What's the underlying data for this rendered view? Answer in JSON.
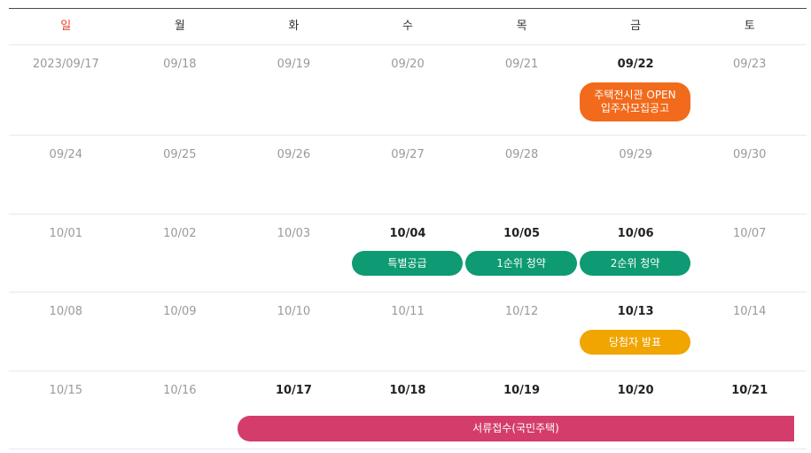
{
  "weekdays": [
    "일",
    "월",
    "화",
    "수",
    "목",
    "금",
    "토"
  ],
  "colors": {
    "sunday": "#e8462a",
    "green": "#0e9a72",
    "orange": "#f26a1b",
    "yellow": "#f0a500",
    "pink": "#d43d6b"
  },
  "weeks": [
    {
      "days": [
        "2023/09/17",
        "09/18",
        "09/19",
        "09/20",
        "09/21",
        "09/22",
        "09/23"
      ]
    },
    {
      "days": [
        "09/24",
        "09/25",
        "09/26",
        "09/27",
        "09/28",
        "09/29",
        "09/30"
      ]
    },
    {
      "days": [
        "10/01",
        "10/02",
        "10/03",
        "10/04",
        "10/05",
        "10/06",
        "10/07"
      ]
    },
    {
      "days": [
        "10/08",
        "10/09",
        "10/10",
        "10/11",
        "10/12",
        "10/13",
        "10/14"
      ]
    },
    {
      "days": [
        "10/15",
        "10/16",
        "10/17",
        "10/18",
        "10/19",
        "10/20",
        "10/21"
      ]
    }
  ],
  "events": {
    "housing_open": {
      "line1": "주택전시관 OPEN",
      "line2": "입주자모집공고"
    },
    "special_supply": "특별공급",
    "first_priority": "1순위 청약",
    "second_priority": "2순위 청약",
    "winner_announcement": "당첨자 발표",
    "document_submission": "서류접수(국민주택)"
  }
}
